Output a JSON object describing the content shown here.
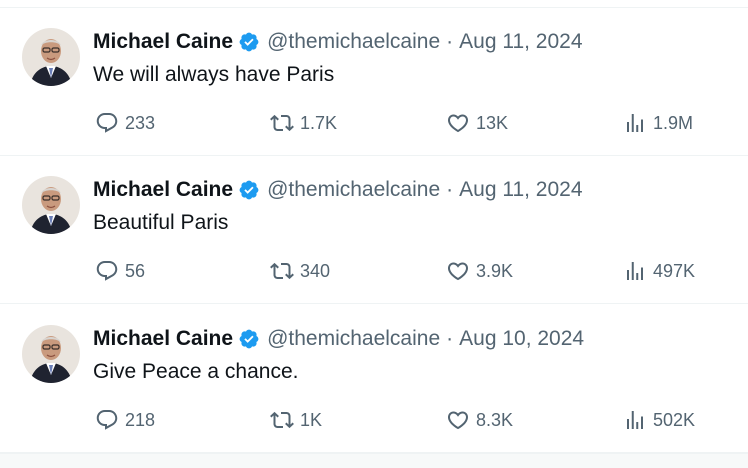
{
  "theme": {
    "text": "#0f1419",
    "secondary": "#536471",
    "verified": "#1d9bf0",
    "divider": "#eff3f4"
  },
  "icons": {
    "reply": "reply-icon",
    "retweet": "retweet-icon",
    "like": "heart-icon",
    "views": "views-icon",
    "verified": "verified-badge-icon"
  },
  "tweets": [
    {
      "name": "Michael Caine",
      "handle": "@themichaelcaine",
      "separator": "·",
      "date": "Aug 11, 2024",
      "text": "We will always have Paris",
      "replies": "233",
      "retweets": "1.7K",
      "likes": "13K",
      "views": "1.9M"
    },
    {
      "name": "Michael Caine",
      "handle": "@themichaelcaine",
      "separator": "·",
      "date": "Aug 11, 2024",
      "text": "Beautiful Paris",
      "replies": "56",
      "retweets": "340",
      "likes": "3.9K",
      "views": "497K"
    },
    {
      "name": "Michael Caine",
      "handle": "@themichaelcaine",
      "separator": "·",
      "date": "Aug 10, 2024",
      "text": "Give Peace a chance.",
      "replies": "218",
      "retweets": "1K",
      "likes": "8.3K",
      "views": "502K"
    }
  ]
}
